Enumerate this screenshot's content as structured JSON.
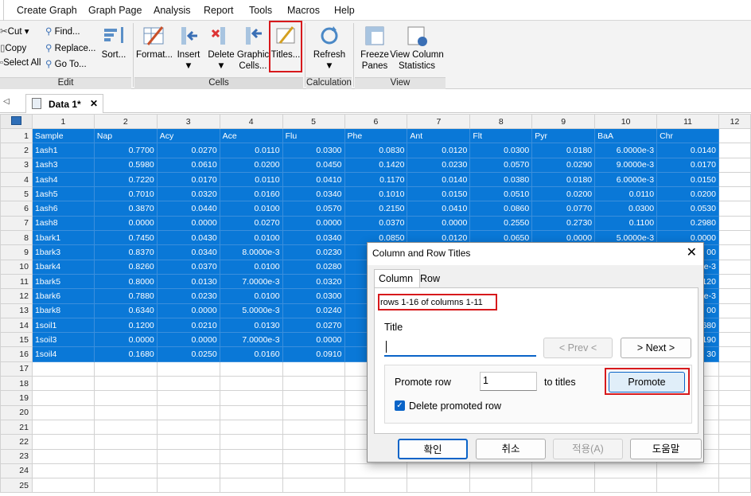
{
  "menu": [
    "Create Graph",
    "Graph Page",
    "Analysis",
    "Report",
    "Tools",
    "Macros",
    "Help"
  ],
  "ribbon": {
    "edit": {
      "label": "Edit",
      "cut": "Cut ▾",
      "copy": "Copy",
      "select_all": "Select All",
      "find": "Find...",
      "replace": "Replace...",
      "goto": "Go To...",
      "sort": "Sort..."
    },
    "cells": {
      "label": "Cells",
      "format": "Format...",
      "insert": "Insert",
      "delete": "Delete",
      "graphic_cells_1": "Graphic",
      "graphic_cells_2": "Cells...",
      "titles": "Titles..."
    },
    "calculation": {
      "label": "Calculation",
      "refresh": "Refresh"
    },
    "view": {
      "label": "View",
      "freeze_1": "Freeze",
      "freeze_2": "Panes",
      "stats_1": "View Column",
      "stats_2": "Statistics"
    }
  },
  "tab": {
    "title": "Data 1*",
    "close": "✕",
    "nav": "◁"
  },
  "columns": [
    "1",
    "2",
    "3",
    "4",
    "5",
    "6",
    "7",
    "8",
    "9",
    "10",
    "11",
    "12"
  ],
  "rows": [
    [
      "Sample",
      "Nap",
      "Acy",
      "Ace",
      "Flu",
      "Phe",
      "Ant",
      "Flt",
      "Pyr",
      "BaA",
      "Chr"
    ],
    [
      "1ash1",
      "0.7700",
      "0.0270",
      "0.0110",
      "0.0300",
      "0.0830",
      "0.0120",
      "0.0300",
      "0.0180",
      "6.0000e-3",
      "0.0140"
    ],
    [
      "1ash3",
      "0.5980",
      "0.0610",
      "0.0200",
      "0.0450",
      "0.1420",
      "0.0230",
      "0.0570",
      "0.0290",
      "9.0000e-3",
      "0.0170"
    ],
    [
      "1ash4",
      "0.7220",
      "0.0170",
      "0.0110",
      "0.0410",
      "0.1170",
      "0.0140",
      "0.0380",
      "0.0180",
      "6.0000e-3",
      "0.0150"
    ],
    [
      "1ash5",
      "0.7010",
      "0.0320",
      "0.0160",
      "0.0340",
      "0.1010",
      "0.0150",
      "0.0510",
      "0.0200",
      "0.0110",
      "0.0200"
    ],
    [
      "1ash6",
      "0.3870",
      "0.0440",
      "0.0100",
      "0.0570",
      "0.2150",
      "0.0410",
      "0.0860",
      "0.0770",
      "0.0300",
      "0.0530"
    ],
    [
      "1ash8",
      "0.0000",
      "0.0000",
      "0.0270",
      "0.0000",
      "0.0370",
      "0.0000",
      "0.2550",
      "0.2730",
      "0.1100",
      "0.2980"
    ],
    [
      "1bark1",
      "0.7450",
      "0.0430",
      "0.0100",
      "0.0340",
      "0.0850",
      "0.0120",
      "0.0650",
      "0.0000",
      "5.0000e-3",
      "0.0000"
    ],
    [
      "1bark3",
      "0.8370",
      "0.0340",
      "8.0000e-3",
      "0.0230",
      "",
      "",
      "",
      "",
      "",
      "00"
    ],
    [
      "1bark4",
      "0.8260",
      "0.0370",
      "0.0100",
      "0.0280",
      "",
      "",
      "",
      "",
      "",
      "e-3"
    ],
    [
      "1bark5",
      "0.8000",
      "0.0130",
      "7.0000e-3",
      "0.0320",
      "",
      "",
      "",
      "",
      "",
      "120"
    ],
    [
      "1bark6",
      "0.7880",
      "0.0230",
      "0.0100",
      "0.0300",
      "",
      "",
      "",
      "",
      "",
      "e-3"
    ],
    [
      "1bark8",
      "0.6340",
      "0.0000",
      "5.0000e-3",
      "0.0240",
      "",
      "",
      "",
      "",
      "",
      "00"
    ],
    [
      "1soil1",
      "0.1200",
      "0.0210",
      "0.0130",
      "0.0270",
      "",
      "",
      "",
      "",
      "",
      "680"
    ],
    [
      "1soil3",
      "0.0000",
      "0.0000",
      "7.0000e-3",
      "0.0000",
      "",
      "",
      "",
      "",
      "",
      "190"
    ],
    [
      "1soil4",
      "0.1680",
      "0.0250",
      "0.0160",
      "0.0910",
      "",
      "",
      "",
      "",
      "",
      "30"
    ]
  ],
  "empty_rows": [
    "17",
    "18",
    "19",
    "20",
    "21",
    "22",
    "23",
    "24",
    "25"
  ],
  "dialog": {
    "title": "Column and Row Titles",
    "close": "✕",
    "tab_column": "Column",
    "tab_row": "Row",
    "range": "rows 1-16 of columns 1-11",
    "title_label": "Title",
    "title_value": "",
    "prev": "< Prev <",
    "next": "> Next >",
    "promote_label": "Promote row",
    "promote_value": "1",
    "to_titles": "to titles",
    "promote": "Promote",
    "delete_check": "Delete promoted row",
    "ok": "확인",
    "cancel": "취소",
    "apply": "적용(A)",
    "help": "도움말"
  }
}
